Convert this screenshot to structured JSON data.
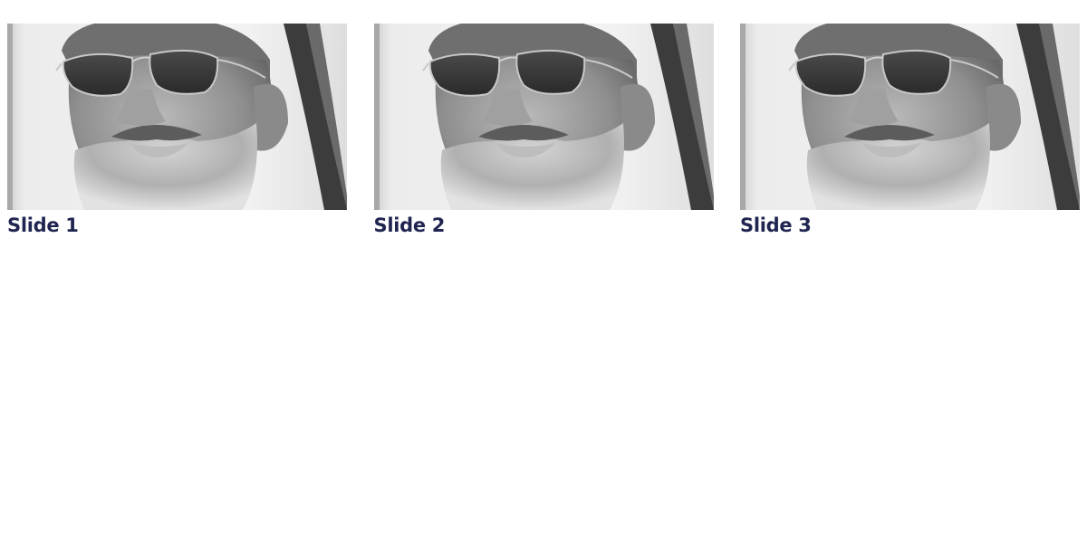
{
  "slides": [
    {
      "title": "Slide 1",
      "image": "portrait-photo"
    },
    {
      "title": "Slide 2",
      "image": "portrait-photo"
    },
    {
      "title": "Slide 3",
      "image": "portrait-photo"
    }
  ],
  "colors": {
    "title": "#1f2450",
    "background": "#ffffff"
  }
}
